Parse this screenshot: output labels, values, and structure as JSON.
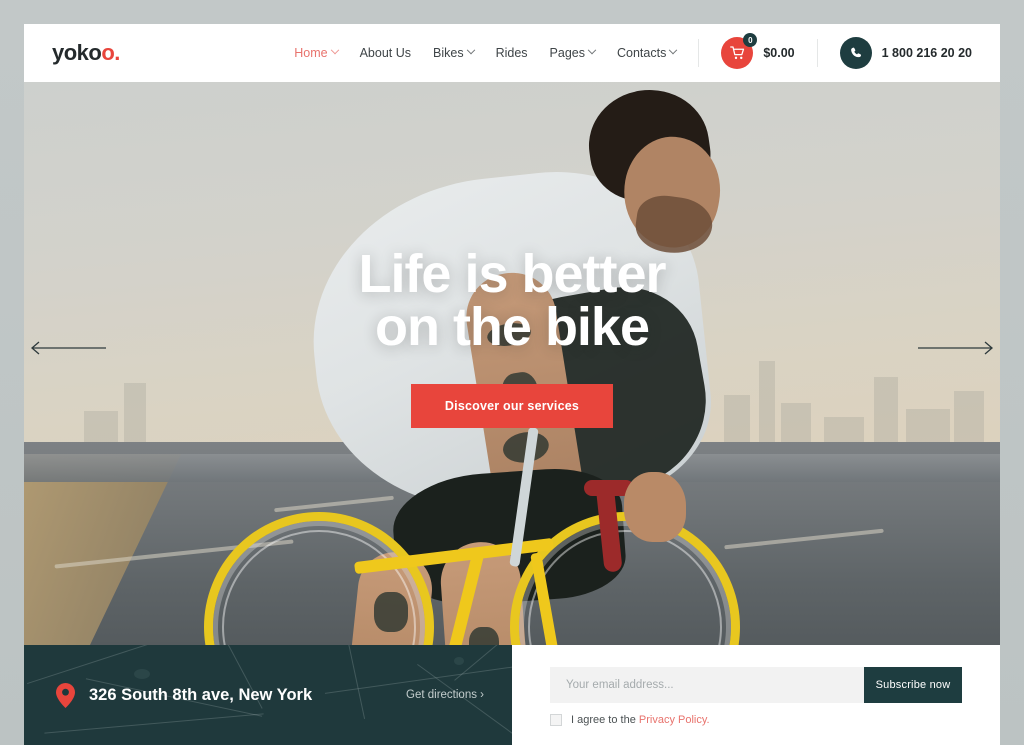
{
  "brand": {
    "name": "yoko",
    "accent_suffix": "o.",
    "accent_color": "#e8453c"
  },
  "header": {
    "nav": [
      {
        "label": "Home",
        "has_caret": true,
        "active": true
      },
      {
        "label": "About Us",
        "has_caret": false,
        "active": false
      },
      {
        "label": "Bikes",
        "has_caret": true,
        "active": false
      },
      {
        "label": "Rides",
        "has_caret": false,
        "active": false
      },
      {
        "label": "Pages",
        "has_caret": true,
        "active": false
      },
      {
        "label": "Contacts",
        "has_caret": true,
        "active": false
      }
    ],
    "cart": {
      "icon": "shopping-cart-icon",
      "count": "0",
      "price": "$0.00"
    },
    "phone": {
      "icon": "phone-icon",
      "number": "1 800 216 20 20"
    }
  },
  "hero": {
    "title_line1": "Life is better",
    "title_line2": "on the bike",
    "cta_label": "Discover our services",
    "prev_icon": "arrow-left-icon",
    "next_icon": "arrow-right-icon"
  },
  "location": {
    "pin_icon": "map-pin-icon",
    "address": "326 South 8th ave, New York",
    "directions_label": "Get directions ›"
  },
  "newsletter": {
    "email_placeholder": "Your email address...",
    "email_value": "",
    "subscribe_label": "Subscribe now",
    "agree_prefix": "I agree to the ",
    "privacy_label": "Privacy Policy."
  },
  "colors": {
    "accent_red": "#e8453c",
    "dark_teal": "#1e3d40",
    "map_teal": "#1f393c",
    "page_bg": "#bfc6c6"
  }
}
